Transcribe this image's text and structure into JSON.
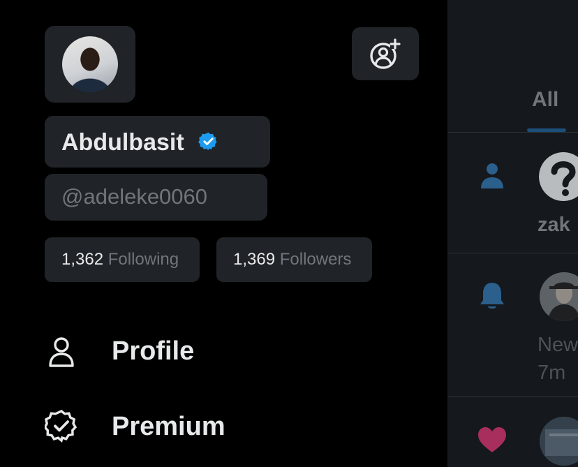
{
  "account": {
    "display_name": "Abdulbasit",
    "handle": "@adeleke0060"
  },
  "stats": {
    "following_count": "1,362",
    "following_label": "Following",
    "followers_count": "1,369",
    "followers_label": "Followers"
  },
  "menu": [
    {
      "label": "Profile",
      "icon": "person-icon"
    },
    {
      "label": "Premium",
      "icon": "verified-badge-icon"
    }
  ],
  "notifications": {
    "tab_all": "All",
    "items": [
      {
        "type_icon": "person-icon",
        "text": "zak"
      },
      {
        "type_icon": "bell-icon",
        "text": "New",
        "time": "7m"
      },
      {
        "type_icon": "heart-icon"
      }
    ]
  },
  "colors": {
    "background": "#000000",
    "panel": "#202327",
    "feed_background": "#15181c",
    "verified_blue": "#1d9bf0",
    "muted_text": "#71767b",
    "heart": "#c7306a"
  }
}
